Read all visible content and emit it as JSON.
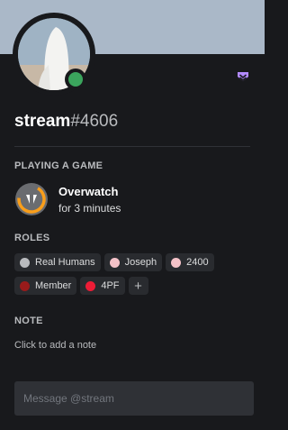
{
  "user": {
    "name": "stream",
    "tag": "#4606",
    "status_color": "#3ba55d",
    "badge_icon": "nitro-badge-icon"
  },
  "activity": {
    "section_title": "PLAYING A GAME",
    "game": "Overwatch",
    "duration": "for 3 minutes",
    "icon": "overwatch-icon"
  },
  "roles": {
    "section_title": "ROLES",
    "items": [
      {
        "label": "Real Humans",
        "color": "#b9bbbe"
      },
      {
        "label": "Joseph",
        "color": "#f4c2c8"
      },
      {
        "label": "2400",
        "color": "#f4c2c8"
      },
      {
        "label": "Member",
        "color": "#991b1b"
      },
      {
        "label": "4PF",
        "color": "#ed1c36"
      }
    ],
    "add_label": "+"
  },
  "note": {
    "section_title": "NOTE",
    "placeholder": "Click to add a note"
  },
  "message": {
    "placeholder": "Message @stream"
  },
  "colors": {
    "background": "#18191c",
    "accent": "#b38bff"
  }
}
